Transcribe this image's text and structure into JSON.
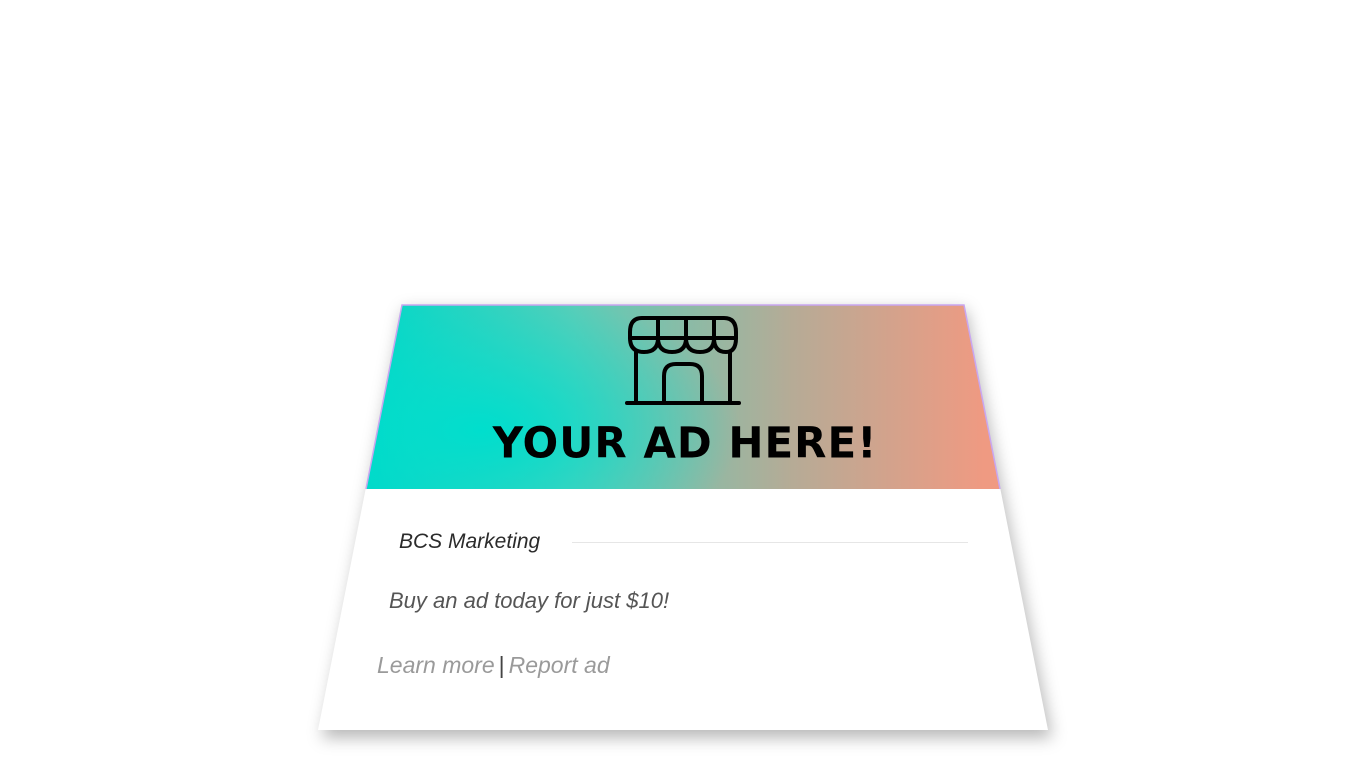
{
  "ad": {
    "banner": {
      "headline": "YOUR AD HERE!",
      "icon": "storefront-icon",
      "gradient_colors": [
        "#00d8c8",
        "#ff9178"
      ]
    },
    "advertiser": "BCS Marketing",
    "body": "Buy an ad today for just $10!",
    "links": {
      "learn_more": "Learn more",
      "separator": "|",
      "report": "Report ad"
    }
  }
}
